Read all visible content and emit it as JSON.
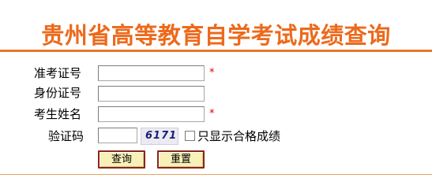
{
  "header": {
    "title": "贵州省高等教育自学考试成绩查询",
    "accent_color": "#ec6a1c"
  },
  "form": {
    "fields": [
      {
        "label": "准考证号",
        "value": "",
        "required": true,
        "required_mark": "*"
      },
      {
        "label": "身份证号",
        "value": "",
        "required": false
      },
      {
        "label": "考生姓名",
        "value": "",
        "required": true,
        "required_mark": "*"
      },
      {
        "label": "验证码",
        "value": "",
        "required": false
      }
    ],
    "captcha_code": "6171",
    "checkbox": {
      "label": "只显示合格成绩",
      "checked": false
    },
    "buttons": {
      "query_label": "查询",
      "reset_label": "重置"
    }
  }
}
